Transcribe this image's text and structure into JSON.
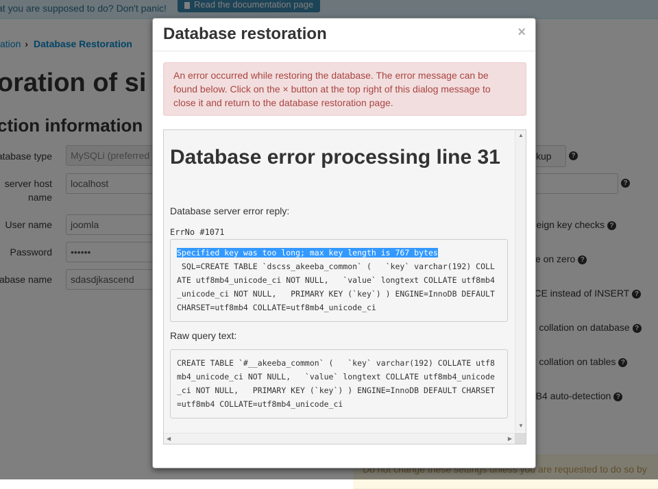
{
  "background": {
    "top_notice": "at you are supposed to do? Don't panic!",
    "doc_button": "Read the documentation page",
    "breadcrumb": {
      "prev": "ation",
      "active": "Database Restoration"
    },
    "page_title": "oration of si",
    "section_title": "ction information",
    "form": {
      "db_type_label": "atabase type",
      "db_type_value": "MySQLi (preferred",
      "host_label": "server host name",
      "host_value": "localhost",
      "user_label": "User name",
      "user_value": "joomla",
      "password_label": "Password",
      "password_value": "••••••",
      "dbname_label": "abase name",
      "dbname_value": "sdasdjkascend"
    },
    "right": {
      "backup_button": "ckup",
      "opt_foreign_key": "oreign key checks",
      "opt_value_zero": "lue on zero",
      "opt_replace": "ACE instead of INSERT",
      "opt_collation_db": "-8 collation on database",
      "opt_collation_tables": "-8 collation on tables",
      "opt_mb4": "MB4 auto-detection"
    },
    "warning": "Do not change these settings unless you are requested to do so by"
  },
  "modal": {
    "title": "Database restoration",
    "close_label": "×",
    "alert": [
      "An error occurred while restoring the database. The error message can be",
      "found below. Click on the × button at the top right of this dialog message to",
      "close it and return to the database restoration page."
    ],
    "error": {
      "heading": "Database error processing line 31",
      "reply_label": "Database server error reply:",
      "errno": "ErrNo #1071",
      "message_highlighted": "Specified key was too long; max key length is 767 bytes",
      "message_lines": [
        " SQL=CREATE TABLE `dscss_akeeba_common` (   `key` varchar(192) COLL",
        "ATE utf8mb4_unicode_ci NOT NULL,   `value` longtext COLLATE utf8mb4",
        "_unicode_ci NOT NULL,   PRIMARY KEY (`key`) ) ENGINE=InnoDB DEFAULT",
        "CHARSET=utf8mb4 COLLATE=utf8mb4_unicode_ci"
      ],
      "raw_label": "Raw query text:",
      "raw_lines": [
        "CREATE TABLE `#__akeeba_common` (   `key` varchar(192) COLLATE utf8",
        "mb4_unicode_ci NOT NULL,   `value` longtext COLLATE utf8mb4_unicode",
        "_ci NOT NULL,   PRIMARY KEY (`key`) ) ENGINE=InnoDB DEFAULT CHARSET",
        "=utf8mb4 COLLATE=utf8mb4_unicode_ci"
      ]
    }
  },
  "colors": {
    "alert_bg": "#f2dede",
    "alert_text": "#a94442",
    "selection": "#3399ff",
    "link": "#0088cc"
  }
}
